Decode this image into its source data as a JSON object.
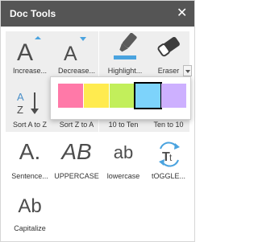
{
  "header": {
    "title": "Doc Tools",
    "close_glyph": "✕"
  },
  "tools": {
    "increase": {
      "label": "Increase...",
      "icon": "increase-font-icon"
    },
    "decrease": {
      "label": "Decrease...",
      "icon": "decrease-font-icon"
    },
    "highlight": {
      "label": "Highlight...",
      "icon": "highlighter-icon"
    },
    "eraser": {
      "label": "Eraser",
      "icon": "eraser-icon"
    },
    "sort_az": {
      "label": "Sort A to Z",
      "icon": "sort-az-icon"
    },
    "sort_za": {
      "label": "Sort Z to A",
      "icon": "sort-za-icon"
    },
    "to_ten": {
      "label": "10 to Ten"
    },
    "ten_to": {
      "label": "Ten to 10"
    },
    "sentence": {
      "label": "Sentence...",
      "glyph": "A."
    },
    "uppercase": {
      "label": "UPPERCASE",
      "glyph": "AB"
    },
    "lowercase": {
      "label": "lowercase",
      "glyph": "ab"
    },
    "toggle": {
      "label": "tOGGLE...",
      "glyph": "Tt"
    },
    "capitalize": {
      "label": "Capitalize",
      "glyph": "Ab"
    }
  },
  "highlight_palette": {
    "colors": [
      "#ff79a8",
      "#ffeb4f",
      "#c2ef5b",
      "#7dd3fb",
      "#cdb0ff"
    ],
    "selected_index": 3
  },
  "accent_color": "#4aa3df"
}
